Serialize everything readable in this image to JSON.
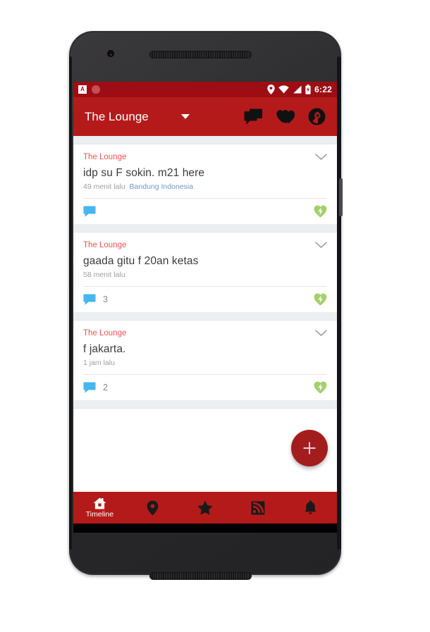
{
  "status_bar": {
    "badge_letter": "A",
    "notif_circle": "circle-notification-icon",
    "icons": [
      "location-icon",
      "wifi-icon",
      "signal-icon",
      "battery-icon"
    ],
    "time": "6:22"
  },
  "toolbar": {
    "title": "The Lounge",
    "dropdown_icon": "chevron-down-icon",
    "actions": [
      {
        "name": "messages-icon",
        "label": "Messages"
      },
      {
        "name": "hearts-icon",
        "label": "Favorites"
      },
      {
        "name": "profile-icon",
        "label": "Profile"
      }
    ]
  },
  "posts": [
    {
      "channel": "The Lounge",
      "text": "idp su F sokin. m21 here",
      "time": "49 menit lalu",
      "location": "Bandung Indonesia",
      "comments": "",
      "vote_icon": "heart-bolt-icon",
      "expand_icon": "chevron-down-icon"
    },
    {
      "channel": "The Lounge",
      "text": "gaada gitu f 20an ketas",
      "time": "58 menit lalu",
      "location": "",
      "comments": "3",
      "vote_icon": "heart-bolt-icon",
      "expand_icon": "chevron-down-icon"
    },
    {
      "channel": "The Lounge",
      "text": "f jakarta.",
      "time": "1 jam lalu",
      "location": "",
      "comments": "2",
      "vote_icon": "heart-bolt-icon",
      "expand_icon": "chevron-down-icon"
    }
  ],
  "fab": {
    "icon": "plus-icon",
    "label": "New post"
  },
  "bottom_nav": [
    {
      "name": "nav-timeline",
      "icon": "home-icon",
      "label": "Timeline",
      "selected": true
    },
    {
      "name": "nav-nearby",
      "icon": "location-pin-icon",
      "label": "",
      "selected": false
    },
    {
      "name": "nav-favorites",
      "icon": "star-icon",
      "label": "",
      "selected": false
    },
    {
      "name": "nav-feed",
      "icon": "rss-icon",
      "label": "",
      "selected": false
    },
    {
      "name": "nav-notifications",
      "icon": "bell-icon",
      "label": "",
      "selected": false
    }
  ],
  "system_nav": [
    {
      "name": "back-button",
      "icon": "triangle-back-icon"
    },
    {
      "name": "home-button",
      "icon": "circle-home-icon"
    },
    {
      "name": "recents-button",
      "icon": "square-recents-icon"
    }
  ],
  "colors": {
    "status_bar": "#9d0d14",
    "toolbar": "#b51a1a",
    "accent_channel": "#ef5350",
    "link": "#7096c4",
    "comment_icon": "#45b6ee",
    "vote_icon": "#a5cf6a",
    "fab": "#a31d1d",
    "gap": "#eceff1"
  }
}
